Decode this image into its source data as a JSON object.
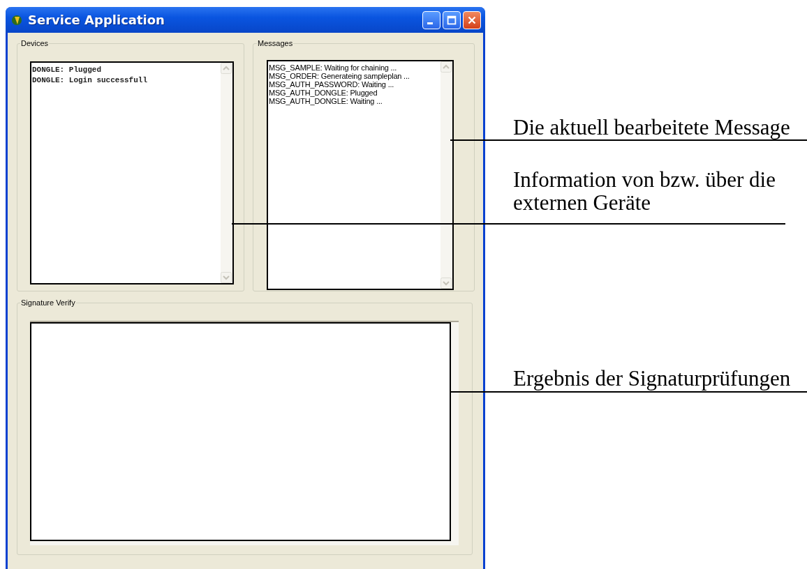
{
  "window": {
    "title": "Service Application"
  },
  "devices": {
    "label": "Devices",
    "lines": [
      "DONGLE: Plugged",
      "DONGLE: Login successfull"
    ]
  },
  "messages": {
    "label": "Messages",
    "lines": [
      "MSG_SAMPLE: Waiting for chaining ...",
      "MSG_ORDER: Generateing sampleplan ...",
      "MSG_AUTH_PASSWORD: Waiting ...",
      "MSG_AUTH_DONGLE: Plugged",
      "MSG_AUTH_DONGLE: Waiting ..."
    ]
  },
  "signature_verify": {
    "label": "Signature Verify"
  },
  "annotations": [
    {
      "text": "Die aktuell bearbeitete Message"
    },
    {
      "text": "Information von bzw. über die externen Geräte"
    },
    {
      "text": "Ergebnis der Signaturprüfungen"
    }
  ]
}
